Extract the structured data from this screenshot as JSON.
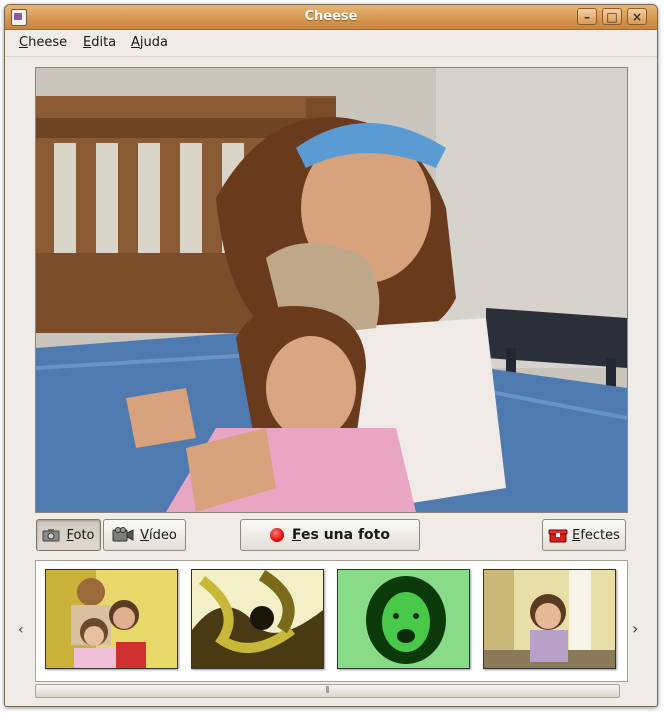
{
  "window": {
    "title": "Cheese"
  },
  "menubar": {
    "items": [
      {
        "accel": "C",
        "rest": "heese"
      },
      {
        "accel": "E",
        "rest": "dita"
      },
      {
        "accel": "A",
        "rest": "juda"
      }
    ]
  },
  "mode_buttons": {
    "photo": {
      "accel": "F",
      "rest": "oto",
      "pressed": true
    },
    "video": {
      "accel": "V",
      "rest": "ídeo",
      "pressed": false
    }
  },
  "capture_button": {
    "accel": "F",
    "rest": "es una foto"
  },
  "effects_button": {
    "accel": "E",
    "rest": "fectes"
  },
  "colors": {
    "titlebar": "#d89b55",
    "window_bg": "#efebe7",
    "record_red": "#e01010"
  }
}
